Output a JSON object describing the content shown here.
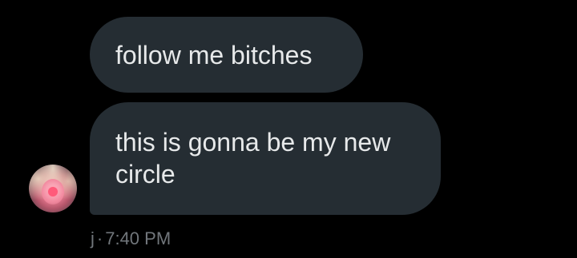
{
  "messages": [
    {
      "text": "follow me bitches"
    },
    {
      "text": "this is gonna be my new circle"
    }
  ],
  "meta": {
    "sender": "j",
    "separator": "·",
    "time": "7:40 PM"
  },
  "colors": {
    "background": "#000000",
    "bubble": "#252d33",
    "text": "#e7e9ea",
    "meta_text": "#71767b"
  },
  "icons": {
    "avatar": "user-avatar"
  }
}
